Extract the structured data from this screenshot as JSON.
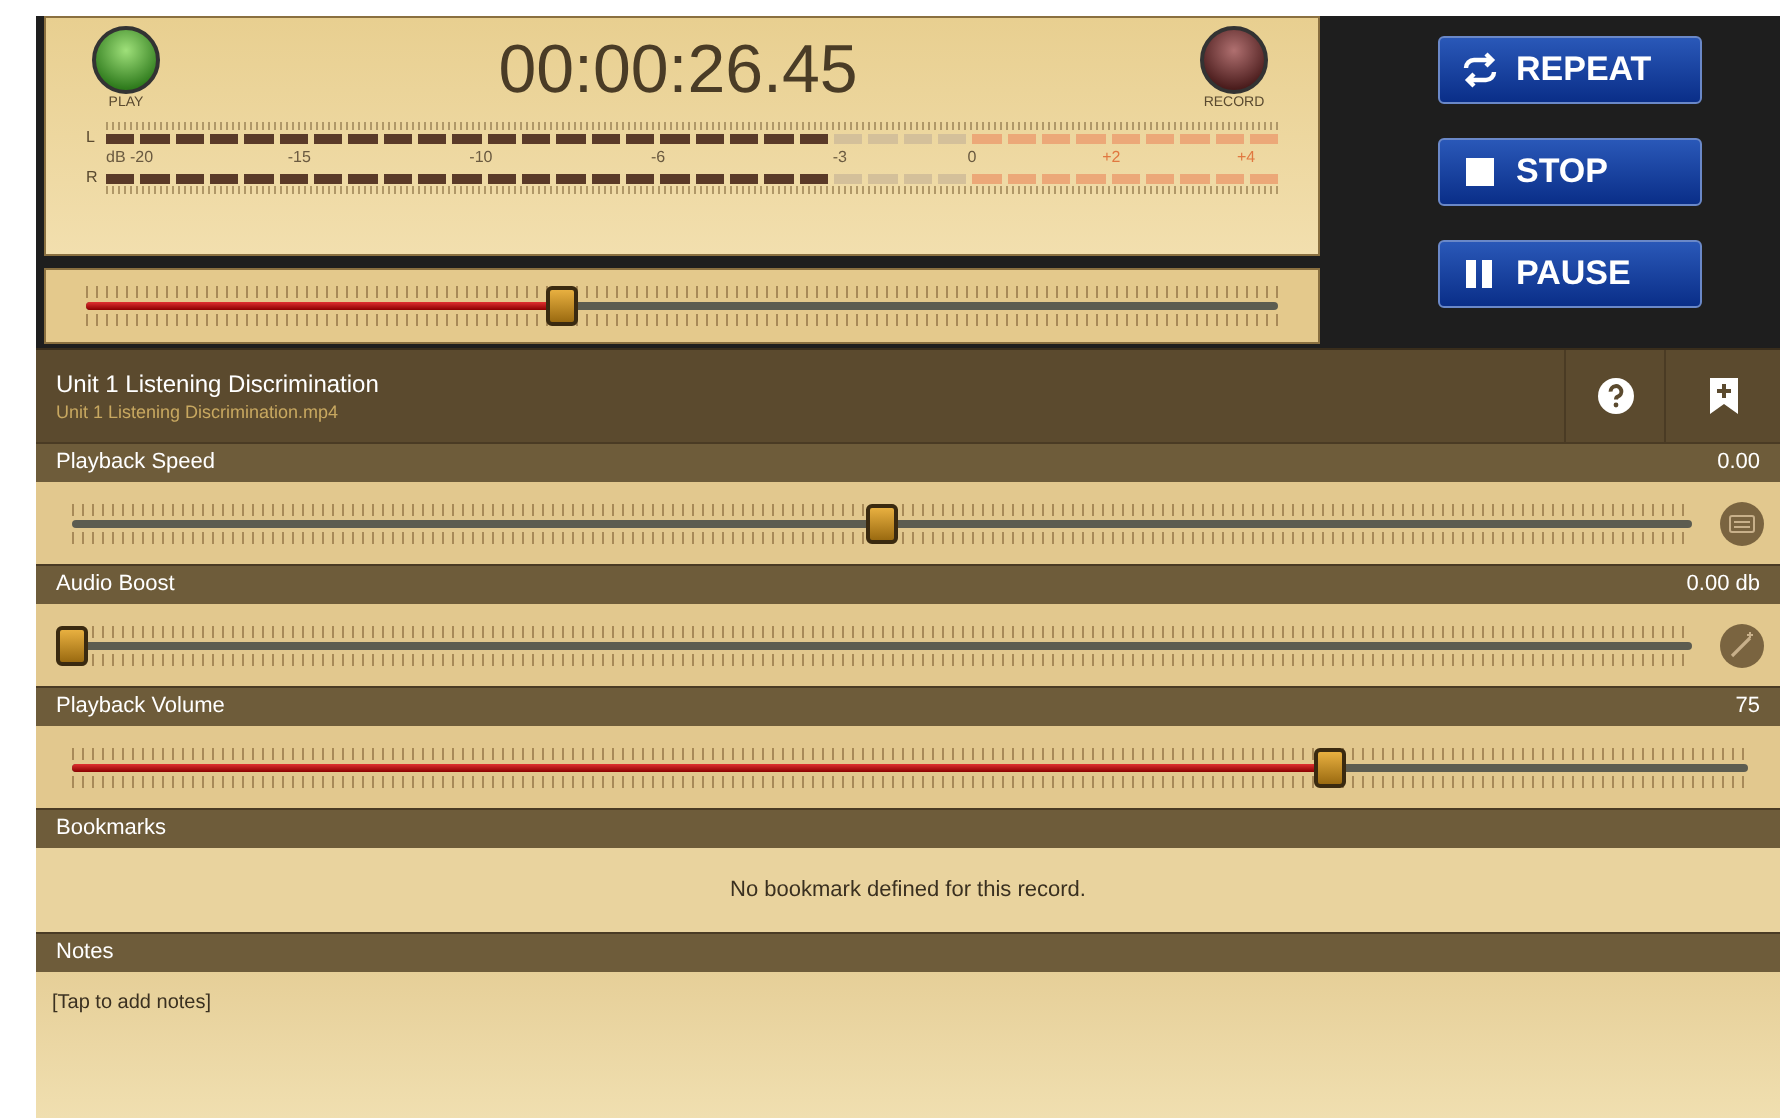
{
  "meter": {
    "play_label": "PLAY",
    "record_label": "RECORD",
    "time": "00:00:26.45",
    "channels": [
      {
        "label": "L",
        "level": 0.62
      },
      {
        "label": "R",
        "level": 0.62
      }
    ],
    "scale": [
      {
        "text": "dB -20",
        "kind": "normal"
      },
      {
        "text": "-15",
        "kind": "normal"
      },
      {
        "text": "-10",
        "kind": "normal"
      },
      {
        "text": "-6",
        "kind": "normal"
      },
      {
        "text": "-3",
        "kind": "normal"
      },
      {
        "text": "0",
        "kind": "normal"
      },
      {
        "text": "+2",
        "kind": "over"
      },
      {
        "text": "+4",
        "kind": "over"
      }
    ]
  },
  "scrubber": {
    "level": 0.4
  },
  "buttons": [
    {
      "label": "REPEAT",
      "kind": "repeat"
    },
    {
      "label": "STOP",
      "kind": "stop"
    },
    {
      "label": "PAUSE",
      "kind": "pause"
    }
  ],
  "track": {
    "title": "Unit 1 Listening Discrimination",
    "file": "Unit 1 Listening Discrimination.mp4"
  },
  "controls": [
    {
      "label": "Playback Speed",
      "reading": "0.00",
      "level": 0.5,
      "kind": "speed"
    },
    {
      "label": "Audio Boost",
      "reading": "0.00 db",
      "level": 0.0,
      "kind": "boost"
    },
    {
      "label": "Playback Volume",
      "reading": "75",
      "level": 0.75,
      "kind": "volume"
    }
  ],
  "bookmarks": {
    "heading": "Bookmarks",
    "empty_text": "No bookmark defined for this record."
  },
  "notes": {
    "heading": "Notes",
    "placeholder": "[Tap to add notes]"
  }
}
